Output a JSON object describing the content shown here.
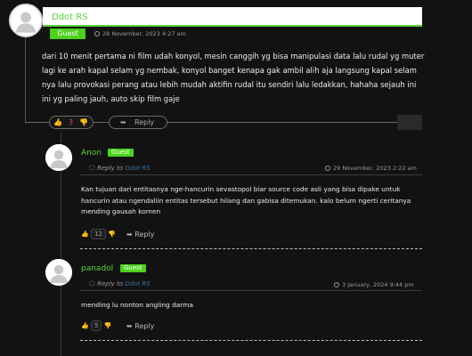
{
  "comments": [
    {
      "author": "Ddot RS",
      "badge": "Guest",
      "timestamp": "28 November, 2023 4:27 am",
      "body": "dari 10 menit pertama ni film udah konyol, mesin canggih yg bisa manipulasi data lalu rudal yg muter lagi ke arah kapal selam yg nembak, konyol banget kenapa gak ambil alih aja langsung kapal selam nya lalu provokasi perang atau lebih mudah aktifin rudal itu sendiri lalu ledakkan, hahaha sejauh ini ini yg paling jauh, auto skip film gaje",
      "votes": "3",
      "reply_label": "Reply"
    }
  ],
  "replies": [
    {
      "author": "Anon",
      "badge": "Guest",
      "reply_to_prefix": "Reply to",
      "reply_to_name": "Ddot RS",
      "timestamp": "29 November, 2023 2:22 am",
      "body": "Kan tujuan dari entitasnya nge-hancurin sevastopol biar source code asli yang bisa dipake untuk hancurin atau ngendaliin entitas tersebut hilang dan gabisa ditemukan. kalo belum ngerti ceritanya mending gausah komen",
      "votes": "12",
      "reply_label": "Reply"
    },
    {
      "author": "panadol",
      "badge": "Guest",
      "reply_to_prefix": "Reply to",
      "reply_to_name": "Ddot RS",
      "timestamp": "3 January, 2024 9:44 pm",
      "body": "mending lu nonton angling darma",
      "votes": "5",
      "reply_label": "Reply"
    }
  ],
  "colors": {
    "accent": "#5bd33f",
    "badge": "#4cd11e",
    "link": "#3b6fa8",
    "vote_count": "#e04a4a",
    "background": "#121212"
  },
  "icons": [
    "avatar-icon",
    "clock-icon",
    "thumbs-up-icon",
    "thumbs-down-icon",
    "reply-arrow-icon",
    "reply-to-icon"
  ]
}
